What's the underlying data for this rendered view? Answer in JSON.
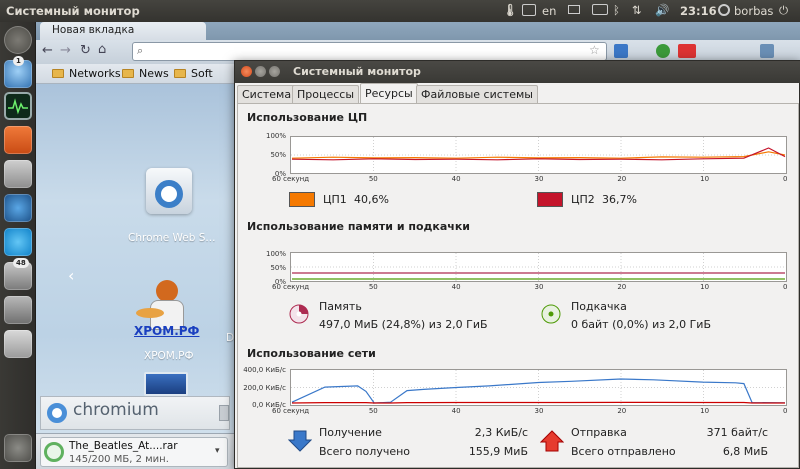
{
  "topbar": {
    "title": "Системный монитор",
    "keyboard_layout": "en",
    "time": "23:16",
    "user": "borbas"
  },
  "launcher": {
    "items": [
      {
        "name": "dash-home",
        "icon": "ubuntu-logo-icon"
      },
      {
        "name": "chromium",
        "icon": "chromium-icon",
        "badge": "1"
      },
      {
        "name": "system-monitor",
        "icon": "system-monitor-icon"
      },
      {
        "name": "files",
        "icon": "folder-icon"
      },
      {
        "name": "calculator",
        "icon": "calculator-icon"
      },
      {
        "name": "deluge",
        "icon": "torrent-icon"
      },
      {
        "name": "skype",
        "icon": "skype-icon"
      },
      {
        "name": "update-manager",
        "icon": "update-icon",
        "badge": "48"
      },
      {
        "name": "workspace",
        "icon": "workspace-icon"
      },
      {
        "name": "drive",
        "icon": "drive-icon"
      },
      {
        "name": "trash",
        "icon": "trash-icon"
      }
    ]
  },
  "browser": {
    "tab_title": "Новая вкладка",
    "omnibox_value": "",
    "bookmarks": [
      "Networks",
      "News",
      "Soft"
    ],
    "apps": [
      {
        "label": "Chrome Web S..."
      },
      {
        "label": "ХРОМ.РФ",
        "logo_text": "ХРОМ.РФ"
      }
    ],
    "chromium_label": "chromium",
    "download": {
      "filename": "The_Beatles_At....rar",
      "status": "145/200 МБ, 2 мин."
    }
  },
  "window": {
    "title": "Системный монитор",
    "tabs": [
      "Система",
      "Процессы",
      "Ресурсы",
      "Файловые системы"
    ],
    "active_tab": "Ресурсы",
    "cpu": {
      "heading": "Использование ЦП",
      "legend": [
        {
          "label": "ЦП1",
          "value": "40,6%",
          "color": "#f57900"
        },
        {
          "label": "ЦП2",
          "value": "36,7%",
          "color": "#c4142b"
        }
      ]
    },
    "memory": {
      "heading": "Использование памяти и подкачки",
      "mem_label": "Память",
      "mem_value": "497,0 МиБ (24,8%) из 2,0 ГиБ",
      "mem_color": "#ad2b51",
      "swap_label": "Подкачка",
      "swap_value": "0 байт (0,0%) из 2,0 ГиБ",
      "swap_color": "#4e9a06"
    },
    "network": {
      "heading": "Использование сети",
      "recv_label": "Получение",
      "recv_rate": "2,3 КиБ/с",
      "recv_total_label": "Всего получено",
      "recv_total": "155,9 МиБ",
      "send_label": "Отправка",
      "send_rate": "371 байт/с",
      "send_total_label": "Всего отправлено",
      "send_total": "6,8 МиБ"
    },
    "axes": {
      "x_ticks": [
        "60 секунд",
        "50",
        "40",
        "30",
        "20",
        "10",
        "0"
      ],
      "pct_ticks": [
        "100%",
        "50%",
        "0%"
      ],
      "net_ticks": [
        "400,0 КиБ/с",
        "200,0 КиБ/с",
        "0,0 КиБ/с"
      ]
    }
  },
  "chart_data": [
    {
      "type": "line",
      "title": "Использование ЦП",
      "x": [
        60,
        55,
        50,
        45,
        40,
        35,
        30,
        25,
        20,
        15,
        10,
        5,
        2,
        0
      ],
      "ylim": [
        0,
        100
      ],
      "series": [
        {
          "name": "ЦП1",
          "values": [
            40,
            43,
            41,
            42,
            40,
            43,
            41,
            42,
            40,
            44,
            43,
            45,
            60,
            50
          ]
        },
        {
          "name": "ЦП2",
          "values": [
            37,
            35,
            38,
            36,
            37,
            35,
            38,
            36,
            37,
            35,
            38,
            40,
            72,
            45
          ]
        }
      ]
    },
    {
      "type": "line",
      "title": "Использование памяти и подкачки",
      "x": [
        60,
        0
      ],
      "ylim": [
        0,
        100
      ],
      "series": [
        {
          "name": "Память",
          "values": [
            24.8,
            24.8
          ]
        },
        {
          "name": "Подкачка",
          "values": [
            0,
            0
          ]
        }
      ]
    },
    {
      "type": "line",
      "title": "Использование сети",
      "x": [
        60,
        56,
        52,
        51,
        50,
        48,
        46,
        44,
        40,
        36,
        30,
        26,
        20,
        16,
        10,
        6,
        5,
        4,
        0
      ],
      "ylim": [
        0,
        400
      ],
      "series": [
        {
          "name": "Получение",
          "values": [
            10,
            205,
            220,
            150,
            0,
            10,
            160,
            175,
            200,
            220,
            265,
            280,
            310,
            300,
            270,
            260,
            250,
            5,
            2
          ]
        },
        {
          "name": "Отправка",
          "values": [
            0,
            5,
            5,
            5,
            0,
            0,
            5,
            5,
            6,
            6,
            7,
            7,
            8,
            8,
            7,
            6,
            6,
            0,
            0
          ]
        }
      ]
    }
  ]
}
